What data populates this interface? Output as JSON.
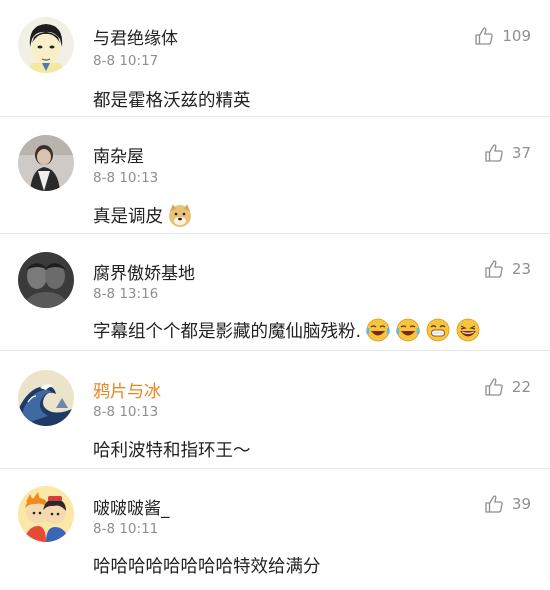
{
  "comments": [
    {
      "name": "与君绝缘体",
      "time": "8-8 10:17",
      "text": "都是霍格沃兹的精英",
      "likes": "109",
      "avatar": "avatar-cartoon-man-icon"
    },
    {
      "name": "南杂屋",
      "time": "8-8 10:13",
      "text": "真是调皮",
      "likes": "37",
      "avatar": "avatar-photo-person-icon",
      "emoji": [
        "doge-emoji"
      ]
    },
    {
      "name": "腐界傲娇基地",
      "time": "8-8 13:16",
      "text": "字幕组个个都是影藏的魔仙脑残粉.",
      "likes": "23",
      "avatar": "avatar-photo-two-people-icon",
      "emoji": [
        "laugh-cry-emoji",
        "laugh-cry-emoji",
        "grin-emoji",
        "laugh-emoji"
      ]
    },
    {
      "name": "鸦片与冰",
      "time": "8-8 10:13",
      "text": "哈利波特和指环王～",
      "likes": "22",
      "avatar": "avatar-great-wave-icon",
      "name_color": "#e9851f"
    },
    {
      "name": "啵啵啵酱_",
      "time": "8-8 10:11",
      "text": "哈哈哈哈哈哈哈哈特效给满分",
      "likes": "39",
      "avatar": "avatar-cartoon-couple-icon"
    }
  ]
}
